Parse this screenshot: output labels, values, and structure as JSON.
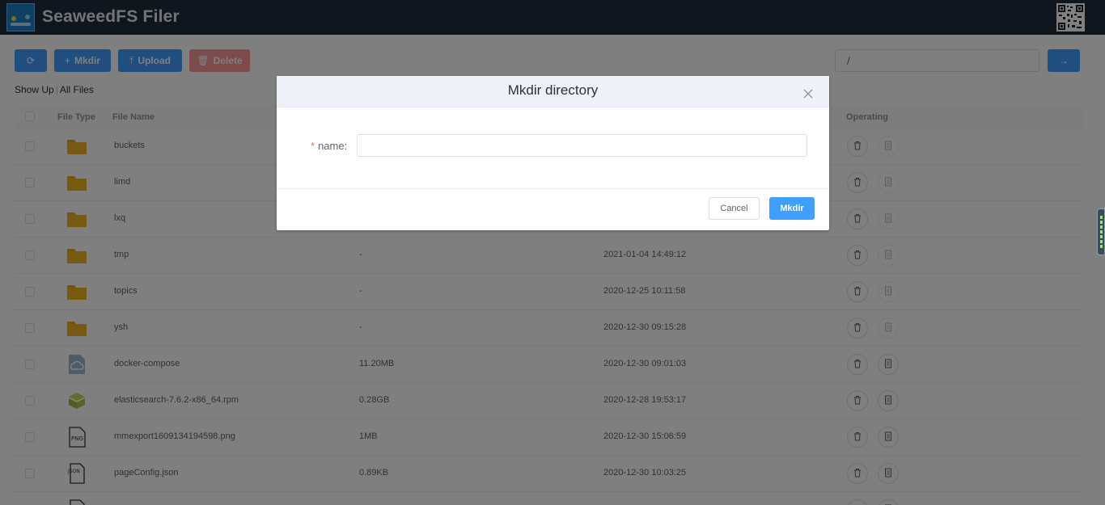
{
  "header": {
    "title": "SeaweedFS Filer",
    "logo_icon": "seaweedfs-logo",
    "qr_icon": "qr-code-icon"
  },
  "toolbar": {
    "refresh_icon": "refresh-icon",
    "mkdir_label": "Mkdir",
    "upload_label": "Upload",
    "delete_label": "Delete",
    "path_value": "/",
    "go_icon": "arrow-right-icon"
  },
  "breadcrumb": {
    "show_up": "Show Up",
    "separator": "|",
    "all_files": "All Files"
  },
  "table": {
    "columns": {
      "file_type": "File Type",
      "file_name": "File Name",
      "operating": "Operating"
    },
    "rows": [
      {
        "type": "folder",
        "name": "buckets",
        "size": "",
        "date": ""
      },
      {
        "type": "folder",
        "name": "limd",
        "size": "",
        "date": ""
      },
      {
        "type": "folder",
        "name": "lxq",
        "size": "",
        "date": ""
      },
      {
        "type": "folder",
        "name": "tmp",
        "size": "-",
        "date": "2021-01-04 14:49:12"
      },
      {
        "type": "folder",
        "name": "topics",
        "size": "-",
        "date": "2020-12-25 10:11:58"
      },
      {
        "type": "folder",
        "name": "ysh",
        "size": "-",
        "date": "2020-12-30 09:15:28"
      },
      {
        "type": "cloud-file",
        "name": "docker-compose",
        "size": "11.20MB",
        "date": "2020-12-30 09:01:03"
      },
      {
        "type": "package",
        "name": "elasticsearch-7.6.2-x86_64.rpm",
        "size": "0.28GB",
        "date": "2020-12-28 19:53:17"
      },
      {
        "type": "png",
        "name": "mmexport1609134194598.png",
        "size": "1MB",
        "date": "2020-12-30 15:06:59"
      },
      {
        "type": "json",
        "name": "pageConfig.json",
        "size": "0.89KB",
        "date": "2020-12-30 10:03:25"
      },
      {
        "type": "file",
        "name": "",
        "size": "",
        "date": ""
      }
    ]
  },
  "dialog": {
    "title": "Mkdir directory",
    "required_mark": "*",
    "name_label": "name:",
    "name_value": "",
    "cancel_label": "Cancel",
    "confirm_label": "Mkdir"
  },
  "colors": {
    "primary": "#409eff",
    "danger": "#f89898",
    "header_bg": "#1e2d3b",
    "folder": "#e6a817"
  }
}
